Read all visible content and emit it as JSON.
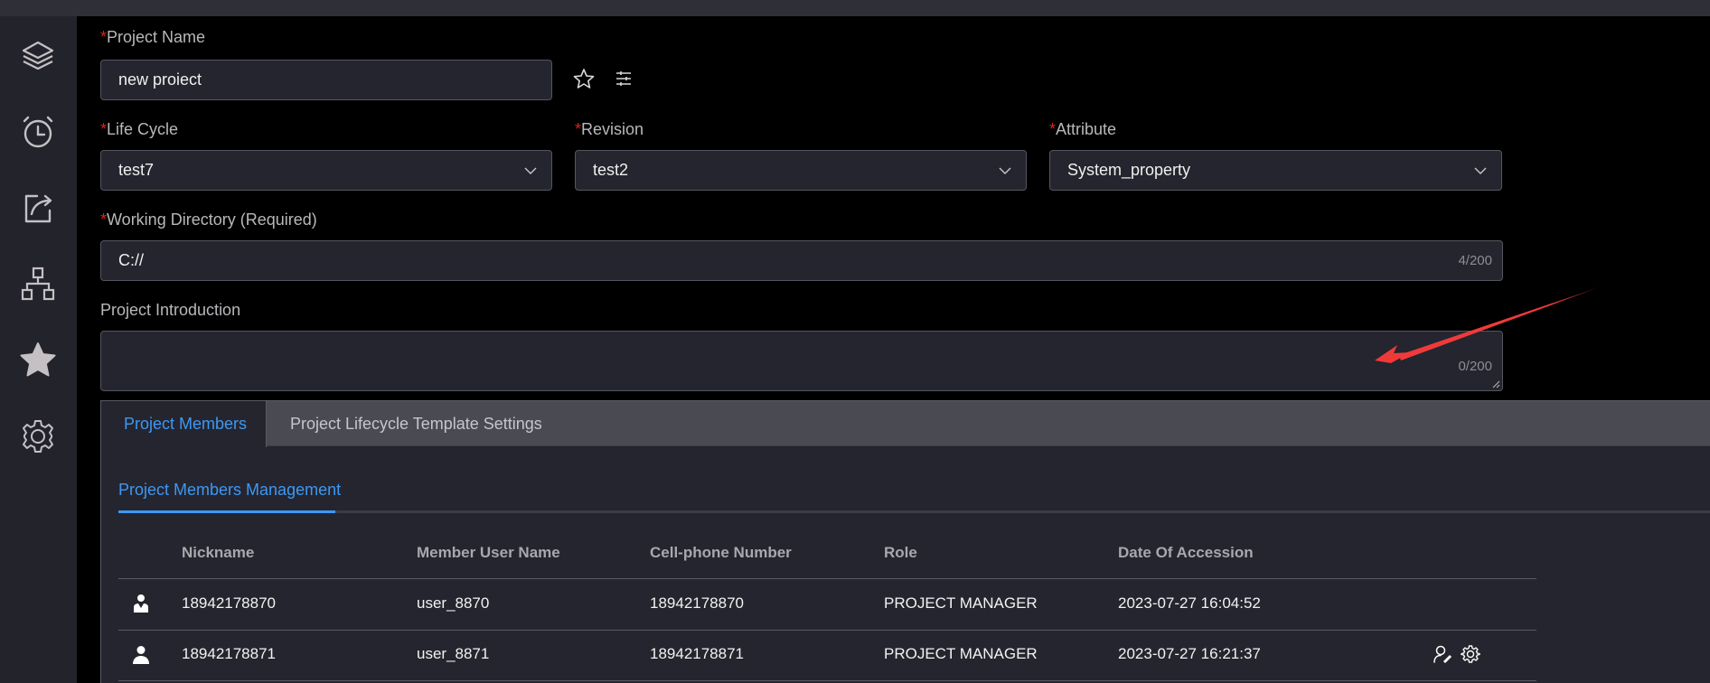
{
  "sidebar": {
    "items": [
      {
        "icon": "layers-icon"
      },
      {
        "icon": "alarm-clock-icon"
      },
      {
        "icon": "share-icon"
      },
      {
        "icon": "hierarchy-icon"
      },
      {
        "icon": "star-icon"
      },
      {
        "icon": "settings-icon"
      }
    ]
  },
  "form": {
    "required_mark": "*",
    "project_name": {
      "label": "Project Name",
      "value": "new proiect"
    },
    "life_cycle": {
      "label": "Life Cycle",
      "value": "test7"
    },
    "revision": {
      "label": "Revision",
      "value": "test2"
    },
    "attribute": {
      "label": "Attribute",
      "value": "System_property"
    },
    "working_directory": {
      "label": "Working Directory (Required)",
      "value": "C://",
      "counter": "4/200"
    },
    "introduction": {
      "label": "Project Introduction",
      "value": "",
      "counter": "0/200"
    }
  },
  "tabs": [
    {
      "label": "Project Members",
      "active": true
    },
    {
      "label": "Project Lifecycle Template Settings",
      "active": false
    }
  ],
  "subtab": {
    "label": "Project Members Management"
  },
  "table": {
    "columns": [
      "Nickname",
      "Member User Name",
      "Cell-phone Number",
      "Role",
      "Date Of Accession"
    ],
    "rows": [
      {
        "icon": "manager-user-icon",
        "nickname": "18942178870",
        "username": "user_8870",
        "phone": "18942178870",
        "role": "PROJECT MANAGER",
        "date": "2023-07-27 16:04:52",
        "actions": []
      },
      {
        "icon": "user-icon",
        "nickname": "18942178871",
        "username": "user_8871",
        "phone": "18942178871",
        "role": "PROJECT MANAGER",
        "date": "2023-07-27 16:21:37",
        "actions": [
          "edit-user-icon",
          "settings-icon"
        ]
      }
    ]
  },
  "annotation": {
    "color": "#f03a3a"
  },
  "colors": {
    "accent": "#3d98f5",
    "required": "#e0201c"
  }
}
